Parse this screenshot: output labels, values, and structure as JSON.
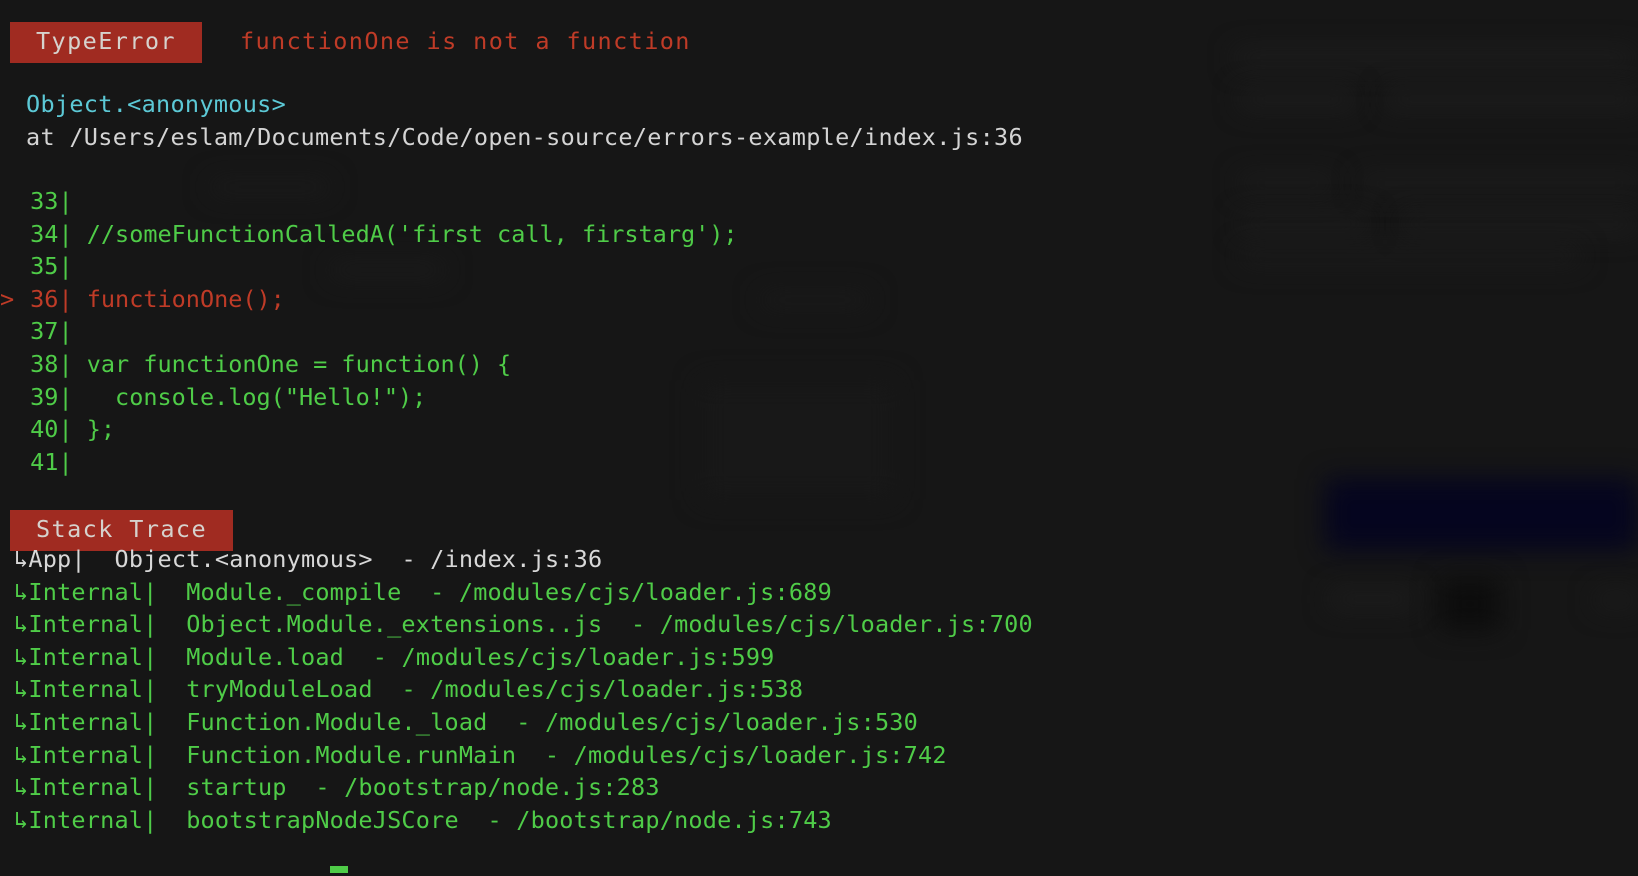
{
  "theme": {
    "terminal_bg": "#161616",
    "badge_bg": "#a02b21",
    "badge_fg": "#d6d2cd",
    "error_red": "#bf3b27",
    "code_green": "#4fcc48",
    "origin_cyan": "#5cc9d6",
    "path_white": "#d4d4d4",
    "cursor_green": "#4fcc48",
    "bg_navy_highlight": "#05051c"
  },
  "error": {
    "type_badge": "TypeError",
    "message": "functionOne is not a function",
    "origin": "Object.<anonymous>",
    "location": "at /Users/eslam/Documents/Code/open-source/errors-example/index.js:36"
  },
  "code_frame": {
    "lines": [
      {
        "marker": " ",
        "number": "33",
        "bar": "|",
        "source": "",
        "is_error": false
      },
      {
        "marker": " ",
        "number": "34",
        "bar": "|",
        "source": " //someFunctionCalledA('first call, firstarg');",
        "is_error": false
      },
      {
        "marker": " ",
        "number": "35",
        "bar": "|",
        "source": "",
        "is_error": false
      },
      {
        "marker": ">",
        "number": "36",
        "bar": "|",
        "source": " functionOne();",
        "is_error": true
      },
      {
        "marker": " ",
        "number": "37",
        "bar": "|",
        "source": "",
        "is_error": false
      },
      {
        "marker": " ",
        "number": "38",
        "bar": "|",
        "source": " var functionOne = function() {",
        "is_error": false
      },
      {
        "marker": " ",
        "number": "39",
        "bar": "|",
        "source": "   console.log(\"Hello!\");",
        "is_error": false
      },
      {
        "marker": " ",
        "number": "40",
        "bar": "|",
        "source": " };",
        "is_error": false
      },
      {
        "marker": " ",
        "number": "41",
        "bar": "|",
        "source": "",
        "is_error": false
      }
    ]
  },
  "stack_trace": {
    "badge": "Stack Trace",
    "arrow_glyph": "↳",
    "frames": [
      {
        "scope": "App|",
        "fn": "Object.<anonymous>",
        "sep": "-",
        "path": "/index.js:36",
        "is_app": true
      },
      {
        "scope": "Internal|",
        "fn": "Module._compile",
        "sep": "-",
        "path": "/modules/cjs/loader.js:689",
        "is_app": false
      },
      {
        "scope": "Internal|",
        "fn": "Object.Module._extensions..js",
        "sep": "-",
        "path": "/modules/cjs/loader.js:700",
        "is_app": false
      },
      {
        "scope": "Internal|",
        "fn": "Module.load",
        "sep": "-",
        "path": "/modules/cjs/loader.js:599",
        "is_app": false
      },
      {
        "scope": "Internal|",
        "fn": "tryModuleLoad",
        "sep": "-",
        "path": "/modules/cjs/loader.js:538",
        "is_app": false
      },
      {
        "scope": "Internal|",
        "fn": "Function.Module._load",
        "sep": "-",
        "path": "/modules/cjs/loader.js:530",
        "is_app": false
      },
      {
        "scope": "Internal|",
        "fn": "Function.Module.runMain",
        "sep": "-",
        "path": "/modules/cjs/loader.js:742",
        "is_app": false
      },
      {
        "scope": "Internal|",
        "fn": "startup",
        "sep": "-",
        "path": "/bootstrap/node.js:283",
        "is_app": false
      },
      {
        "scope": "Internal|",
        "fn": "bootstrapNodeJSCore",
        "sep": "-",
        "path": "/bootstrap/node.js:743",
        "is_app": false
      }
    ]
  },
  "cursor": {
    "visible": true,
    "shape": "underline-block"
  }
}
